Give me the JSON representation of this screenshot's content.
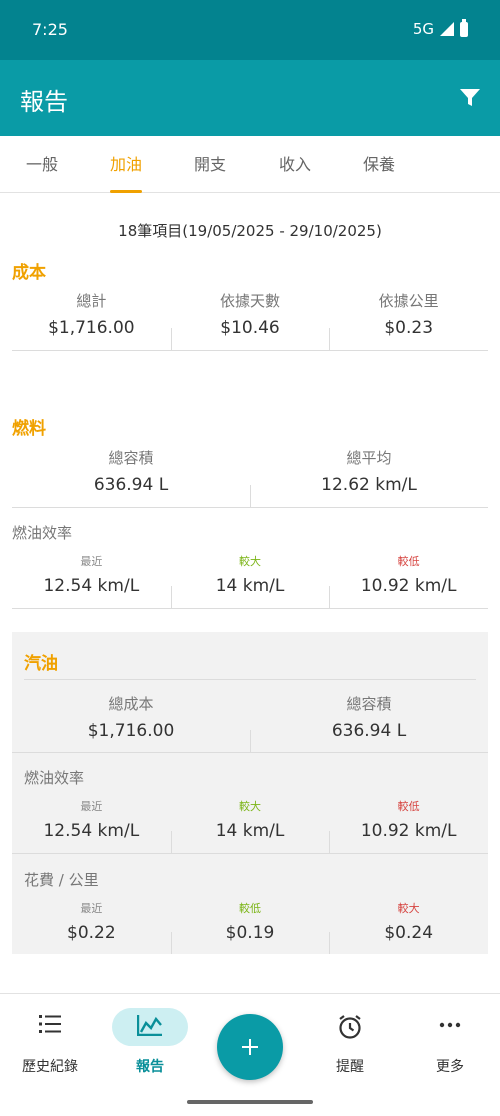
{
  "status": {
    "time": "7:25",
    "network": "5G"
  },
  "app_bar": {
    "title": "報告"
  },
  "tabs": [
    {
      "label": "一般"
    },
    {
      "label": "加油"
    },
    {
      "label": "開支"
    },
    {
      "label": "收入"
    },
    {
      "label": "保養"
    }
  ],
  "date_range": "18筆項目(19/05/2025 - 29/10/2025)",
  "cost": {
    "title": "成本",
    "items": [
      {
        "label": "總計",
        "value": "$1,716.00"
      },
      {
        "label": "依據天數",
        "value": "$10.46"
      },
      {
        "label": "依據公里",
        "value": "$0.23"
      }
    ]
  },
  "fuel": {
    "title": "燃料",
    "totals": [
      {
        "label": "總容積",
        "value": "636.94 L"
      },
      {
        "label": "總平均",
        "value": "12.62 km/L"
      }
    ],
    "efficiency_label": "燃油效率",
    "efficiency": [
      {
        "label": "最近",
        "value": "12.54 km/L"
      },
      {
        "label": "較大",
        "value": "14 km/L"
      },
      {
        "label": "較低",
        "value": "10.92 km/L"
      }
    ]
  },
  "gasoline": {
    "title": "汽油",
    "totals": [
      {
        "label": "總成本",
        "value": "$1,716.00"
      },
      {
        "label": "總容積",
        "value": "636.94 L"
      }
    ],
    "efficiency_label": "燃油效率",
    "efficiency": [
      {
        "label": "最近",
        "value": "12.54 km/L"
      },
      {
        "label": "較大",
        "value": "14 km/L"
      },
      {
        "label": "較低",
        "value": "10.92 km/L"
      }
    ],
    "cost_per_km_label": "花費 / 公里",
    "cost_per_km": [
      {
        "label": "最近",
        "value": "$0.22"
      },
      {
        "label": "較低",
        "value": "$0.19"
      },
      {
        "label": "較大",
        "value": "$0.24"
      }
    ]
  },
  "bottom_nav": [
    {
      "label": "歷史紀錄",
      "icon": "list-icon"
    },
    {
      "label": "報告",
      "icon": "chart-icon"
    },
    {
      "label": "",
      "icon": "add-icon"
    },
    {
      "label": "提醒",
      "icon": "alarm-icon"
    },
    {
      "label": "更多",
      "icon": "more-icon"
    }
  ],
  "colors": {
    "status_bar": "#03838f",
    "app_bar": "#0a9ba6",
    "accent": "#f0a100",
    "green": "#7cb518",
    "red": "#d64541"
  }
}
